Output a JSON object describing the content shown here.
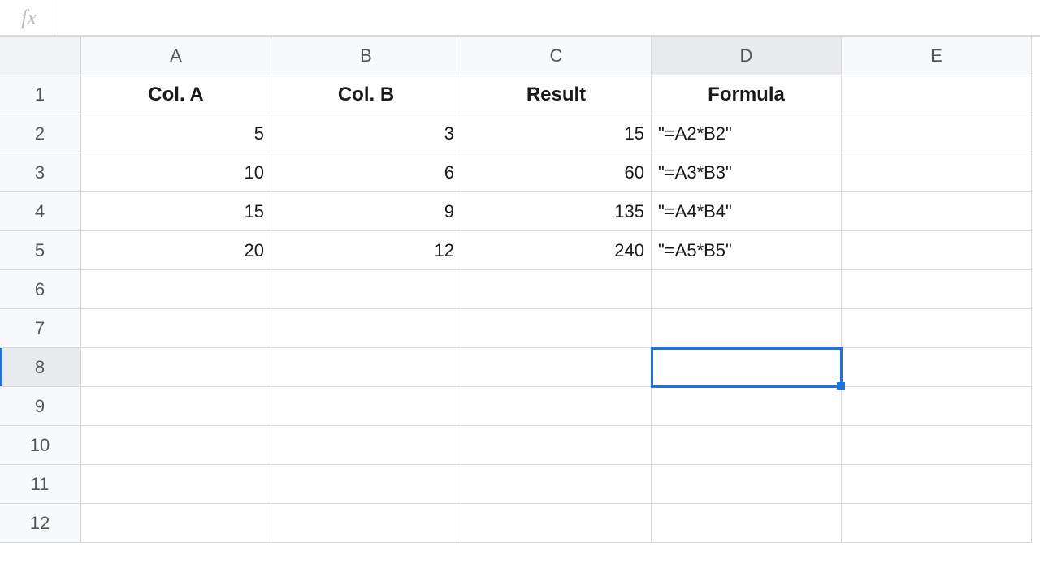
{
  "formula_bar": {
    "fx": "fx",
    "value": ""
  },
  "columns": [
    "A",
    "B",
    "C",
    "D",
    "E"
  ],
  "rows": [
    "1",
    "2",
    "3",
    "4",
    "5",
    "6",
    "7",
    "8",
    "9",
    "10",
    "11",
    "12"
  ],
  "table": {
    "headers": {
      "A": "Col. A",
      "B": "Col. B",
      "C": "Result",
      "D": "Formula"
    },
    "data": [
      {
        "A": "5",
        "B": "3",
        "C": "15",
        "D": "\"=A2*B2\""
      },
      {
        "A": "10",
        "B": "6",
        "C": "60",
        "D": "\"=A3*B3\""
      },
      {
        "A": "15",
        "B": "9",
        "C": "135",
        "D": "\"=A4*B4\""
      },
      {
        "A": "20",
        "B": "12",
        "C": "240",
        "D": "\"=A5*B5\""
      }
    ]
  },
  "selection": {
    "col": "D",
    "row": 8
  },
  "chart_data": {
    "type": "table",
    "columns": [
      "Col. A",
      "Col. B",
      "Result",
      "Formula"
    ],
    "rows": [
      [
        5,
        3,
        15,
        "=A2*B2"
      ],
      [
        10,
        6,
        60,
        "=A3*B3"
      ],
      [
        15,
        9,
        135,
        "=A4*B4"
      ],
      [
        20,
        12,
        240,
        "=A5*B5"
      ]
    ]
  }
}
